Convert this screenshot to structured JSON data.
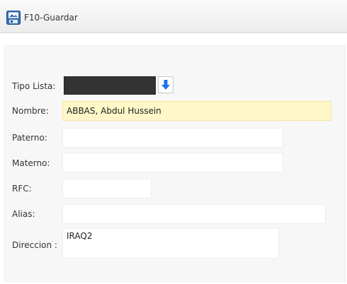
{
  "toolbar": {
    "save_label": "F10-Guardar",
    "save_icon": "save-disk-icon"
  },
  "form": {
    "tipo_lista": {
      "label": "Tipo Lista:",
      "value": ""
    },
    "nombre": {
      "label": "Nombre:",
      "value": "ABBAS, Abdul Hussein"
    },
    "paterno": {
      "label": "Paterno:",
      "value": ""
    },
    "materno": {
      "label": "Materno:",
      "value": ""
    },
    "rfc": {
      "label": "RFC:",
      "value": ""
    },
    "alias": {
      "label": "Alias:",
      "value": ""
    },
    "direccion": {
      "label": "Direccion :",
      "value": "IRAQ2"
    }
  },
  "colors": {
    "highlight": "#fff7c8",
    "arrow": "#1a73e8",
    "select_bg": "#333333"
  }
}
